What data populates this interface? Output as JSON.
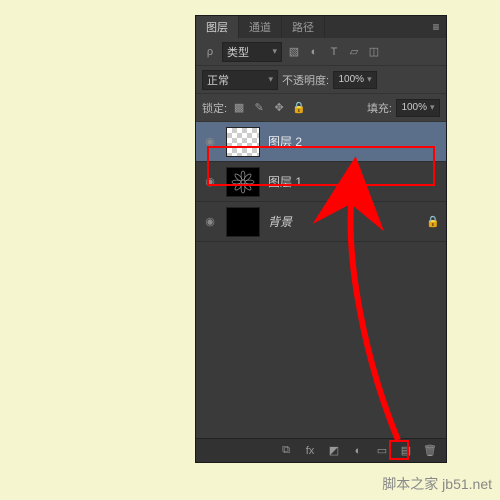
{
  "panel": {
    "tabs": {
      "layers": "图层",
      "channels": "通道",
      "paths": "路径"
    },
    "filter": {
      "kind": "类型"
    },
    "blend": {
      "mode": "正常",
      "opacity_label": "不透明度:",
      "opacity_value": "100%"
    },
    "lock": {
      "label": "锁定:",
      "fill_label": "填充:",
      "fill_value": "100%"
    }
  },
  "layers": [
    {
      "name": "图层 2"
    },
    {
      "name": "图层 1"
    },
    {
      "name": "背景"
    }
  ],
  "footer_icons": {
    "link": "⌘",
    "fx": "fx",
    "mask": "◐",
    "adjust": "◑",
    "group": "▭",
    "new": "▦",
    "trash": "🗑"
  },
  "watermark": "脚本之家  jb51.net"
}
